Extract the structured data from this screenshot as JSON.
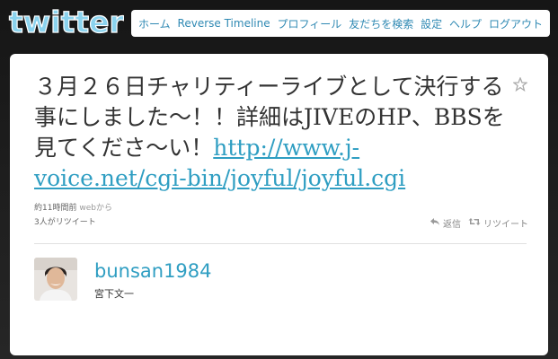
{
  "header": {
    "logo_text": "twitter",
    "nav": {
      "home": "ホーム",
      "reverse_timeline": "Reverse Timeline",
      "profile": "プロフィール",
      "find_friends": "友だちを検索",
      "settings": "設定",
      "help": "ヘルプ",
      "logout": "ログアウト"
    }
  },
  "tweet": {
    "text": "３月２６日チャリティーライブとして決行する事にしました〜！！詳細はJIVEのHP、BBSを見てくださ〜い！",
    "link": "http://www.j-voice.net/cgi-bin/joyful/joyful.cgi",
    "time": "約11時間前",
    "via": "webから",
    "retweet_count": "3人がリツイート",
    "actions": {
      "reply": "返信",
      "retweet": "リツイート"
    }
  },
  "user": {
    "screen_name": "bunsan1984",
    "full_name": "宮下文一"
  },
  "icons": {
    "logo": "twitter-logo",
    "favorite": "star-icon",
    "reply": "reply-icon",
    "retweet": "retweet-icon",
    "avatar": "avatar"
  },
  "colors": {
    "link": "#2f9ec2",
    "nav_link": "#2f89b3",
    "logo": "#8bd3ee",
    "background": "#1a1a1a"
  }
}
